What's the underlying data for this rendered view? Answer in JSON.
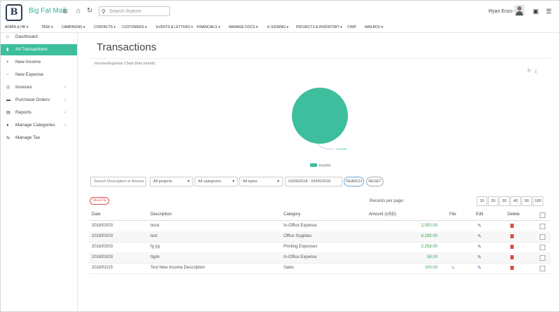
{
  "app": {
    "logo_letter": "B",
    "brand": "Big Fat Mail",
    "search_placeholder": "Search feature",
    "user": "Ryan Enzo ▾"
  },
  "menu": [
    "ADMIN & HR ▾",
    "TASK ▾",
    "CAMPAIGNS ▾",
    "CONTACTS ▾",
    "CUSTOMERS ▾",
    "EVENTS & LETTERS ▾",
    "FINANCIALS ▾",
    "MANAGE DOCS ▾",
    "E-SIGNING ▾",
    "PROJECTS & INVENTORY ▾",
    "CHAT",
    "MAILBOX ▾"
  ],
  "sidebar": [
    {
      "label": "Dashboard",
      "icon": "home-icon",
      "glyph": "⌂",
      "chevron": ""
    },
    {
      "label": "All Transactions",
      "icon": "trash-icon",
      "glyph": "▮",
      "chevron": "",
      "active": true
    },
    {
      "label": "New Income",
      "icon": "plus-icon",
      "glyph": "+",
      "chevron": ""
    },
    {
      "label": "New Expense",
      "icon": "minus-icon",
      "glyph": "−",
      "chevron": ""
    },
    {
      "label": "Invoices",
      "icon": "invoice-icon",
      "glyph": "◎",
      "chevron": "‹"
    },
    {
      "label": "Purchase Orders",
      "icon": "cart-icon",
      "glyph": "▬",
      "chevron": "‹"
    },
    {
      "label": "Reports",
      "icon": "report-icon",
      "glyph": "▤",
      "chevron": "‹"
    },
    {
      "label": "Manage Categories",
      "icon": "category-icon",
      "glyph": "●",
      "chevron": "‹"
    },
    {
      "label": "Manage Tax",
      "icon": "tax-icon",
      "glyph": "⇆",
      "chevron": ""
    }
  ],
  "page": {
    "title": "Transactions",
    "chart_title": "Income/Expense Chart (this month)"
  },
  "chart_data": {
    "type": "pie",
    "categories": [
      "Income"
    ],
    "values": [
      1
    ],
    "legend": [
      "Income"
    ],
    "color": "#3dbf9d"
  },
  "filters": {
    "search_placeholder": "Search Description or Amount",
    "projects": "All projects",
    "categories": "All categories",
    "types": "All types",
    "date_range": "03/06/2018 - 03/06/2018",
    "search_btn": "SEARCH",
    "reset_btn": "RESET"
  },
  "table": {
    "delete_btn": "DELETE",
    "records_label": "Records per page:",
    "page_sizes": [
      "10",
      "20",
      "30",
      "40",
      "50",
      "100"
    ],
    "headers": {
      "date": "Date",
      "description": "Description",
      "category": "Category",
      "amount": "Amount (USD)",
      "file": "File",
      "edit": "Edit",
      "delete": "Delete"
    },
    "rows": [
      {
        "date": "2018/03/03",
        "description": "tesst",
        "category": "In-Office Expense",
        "amount": "2,000.00",
        "file": ""
      },
      {
        "date": "2018/03/03",
        "description": "test",
        "category": "Office Supplies",
        "amount": "8,285.00",
        "file": ""
      },
      {
        "date": "2018/03/03",
        "description": "fg yg",
        "category": "Printing Expenses",
        "amount": "2,258.00",
        "file": ""
      },
      {
        "date": "2018/03/03",
        "description": "ttgdv",
        "category": "In-Office Expense",
        "amount": "58.00",
        "file": ""
      },
      {
        "date": "2018/02/15",
        "description": "Test New Income Description",
        "category": "Sales",
        "amount": "100.00",
        "file": "✎"
      }
    ]
  }
}
